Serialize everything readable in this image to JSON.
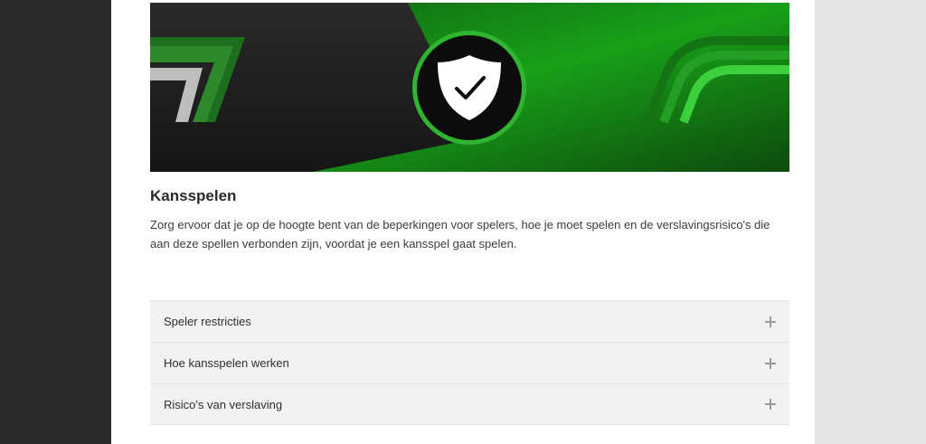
{
  "section": {
    "title": "Kansspelen",
    "description": "Zorg ervoor dat je op de hoogte bent van de beperkingen voor spelers, hoe je moet spelen en de verslavingsrisico's die aan deze spellen verbonden zijn, voordat je een kansspel gaat spelen."
  },
  "accordion": {
    "items": [
      {
        "label": "Speler restricties",
        "icon": "plus-icon"
      },
      {
        "label": "Hoe kansspelen werken",
        "icon": "plus-icon"
      },
      {
        "label": "Risico's van verslaving",
        "icon": "plus-icon"
      }
    ]
  },
  "banner": {
    "icon": "shield-check-icon",
    "colors": {
      "green": "#1faa1f",
      "dark": "#1c1c1c"
    }
  }
}
